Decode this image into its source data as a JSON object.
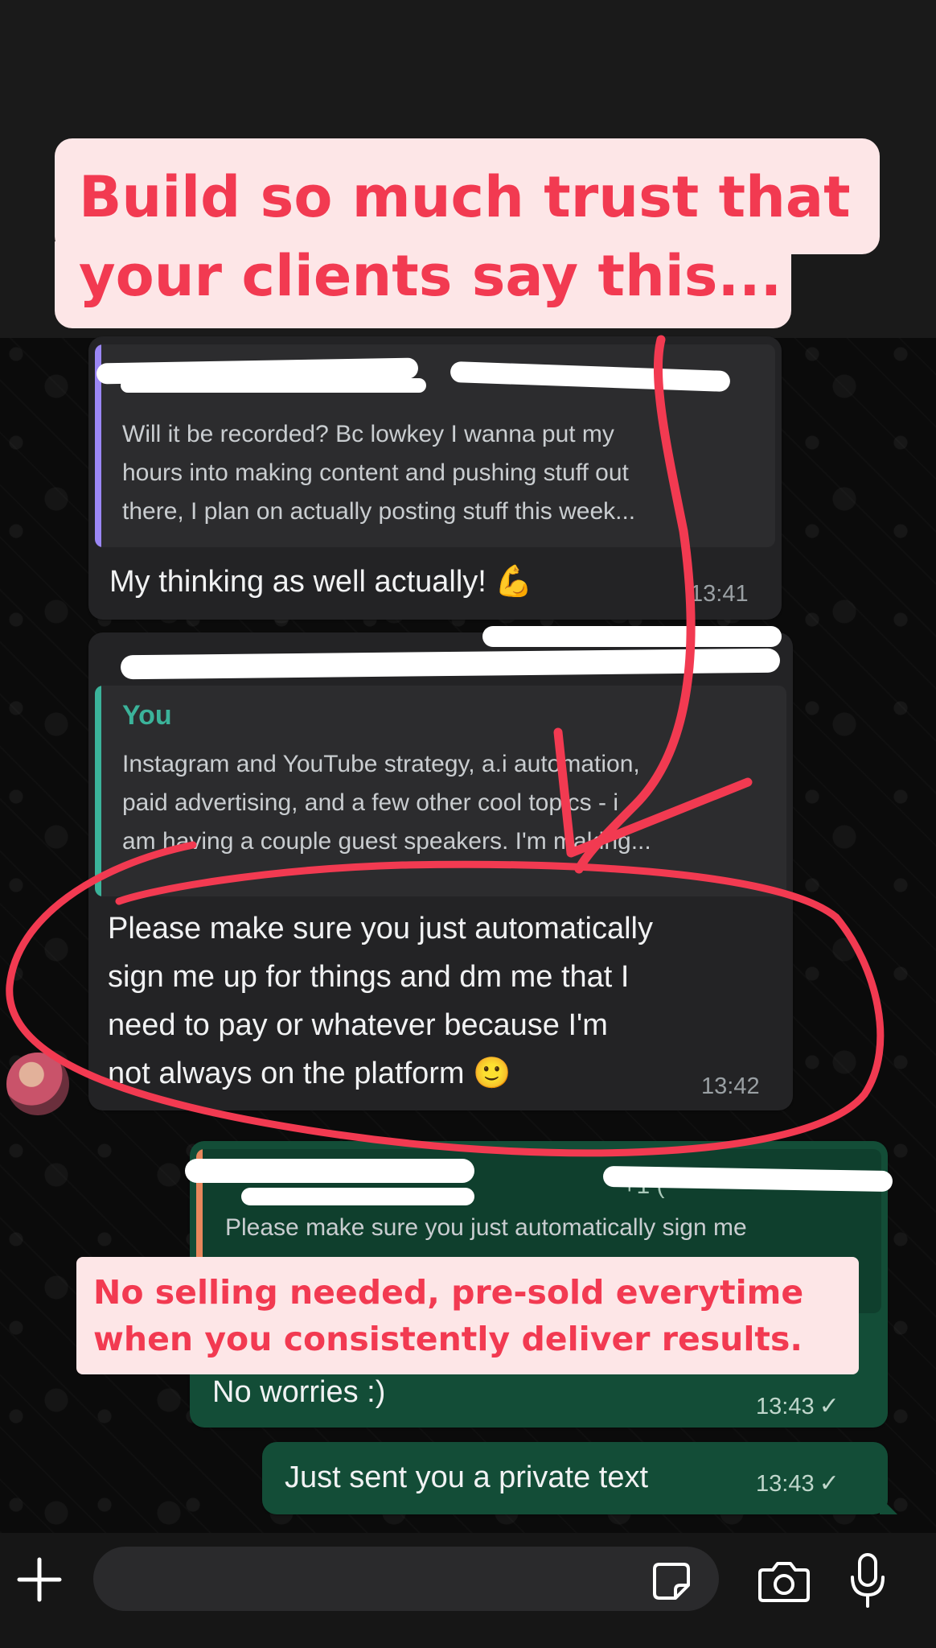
{
  "headline": {
    "line1": "Build so much trust that",
    "line2": "your clients say this..."
  },
  "messages": [
    {
      "quote_author": "",
      "quote_lines": [
        "Will it be recorded? Bc lowkey I wanna put my",
        "hours into making content and pushing stuff out",
        "there, I plan on actually posting stuff this week..."
      ],
      "text": "My thinking as well actually! 💪",
      "time": "13:41"
    },
    {
      "quote_author": "You",
      "quote_lines": [
        "Instagram and YouTube strategy, a.i automation,",
        "paid advertising, and a few other cool topics - i",
        "am having a couple guest speakers. I'm making..."
      ],
      "text_lines": [
        "Please make sure you just automatically",
        "sign me up for things and dm me that I",
        "need to pay or whatever because I'm",
        "not always on the platform 🙂"
      ],
      "time": "13:42"
    },
    {
      "quote_phone_fragment": "+1 (",
      "quote_line": "Please make sure you just automatically sign me",
      "text": "No worries :)",
      "time": "13:43"
    },
    {
      "text": "Just sent you a private text",
      "time": "13:43"
    }
  ],
  "callout": {
    "line1": "No selling needed, pre-sold everytime",
    "line2": "when you consistently deliver results."
  },
  "input_bar": {
    "icons": [
      "plus-icon",
      "sticker-icon",
      "camera-icon",
      "microphone-icon"
    ]
  },
  "colors": {
    "accent_red": "#f23a51",
    "outgoing_bubble": "#134d37",
    "incoming_bubble": "#232325",
    "quote_bar_purple": "#9b87f5",
    "quote_bar_teal": "#3bb39a",
    "quote_bar_orange": "#e8875c"
  }
}
